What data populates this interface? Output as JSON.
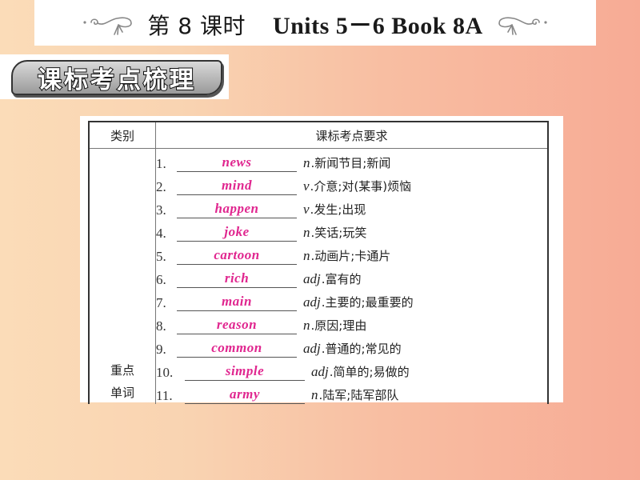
{
  "title": {
    "lesson": "第 8 课时",
    "units": "Units 5－6 Book 8A",
    "left_decoration_icon": "flourish-icon",
    "right_decoration_icon": "flourish-icon"
  },
  "section_badge": {
    "label": "课标考点梳理"
  },
  "table": {
    "headers": {
      "category": "类别",
      "requirement": "课标考点要求"
    },
    "category_label_line1": "重点",
    "category_label_line2": "单词",
    "items": [
      {
        "num": "1.",
        "answer": "news",
        "pos": "n",
        "meaning": "新闻节目;新闻"
      },
      {
        "num": "2.",
        "answer": "mind",
        "pos": "v",
        "meaning": "介意;对(某事)烦恼"
      },
      {
        "num": "3.",
        "answer": "happen",
        "pos": "v",
        "meaning": "发生;出现"
      },
      {
        "num": "4.",
        "answer": "joke",
        "pos": "n",
        "meaning": "笑话;玩笑"
      },
      {
        "num": "5.",
        "answer": "cartoon",
        "pos": "n",
        "meaning": "动画片;卡通片"
      },
      {
        "num": "6.",
        "answer": "rich",
        "pos": "adj",
        "meaning": "富有的"
      },
      {
        "num": "7.",
        "answer": "main",
        "pos": "adj",
        "meaning": "主要的;最重要的"
      },
      {
        "num": "8.",
        "answer": "reason",
        "pos": "n",
        "meaning": "原因;理由"
      },
      {
        "num": "9.",
        "answer": "common",
        "pos": "adj",
        "meaning": "普通的;常见的"
      },
      {
        "num": "10.",
        "answer": "simple",
        "pos": "adj",
        "meaning": "简单的;易做的"
      },
      {
        "num": "11.",
        "answer": "army",
        "pos": "n",
        "meaning": "陆军;陆军部队"
      }
    ]
  },
  "colors": {
    "answer": "#e0268f",
    "background_left": "#fbdcb8",
    "background_right": "#f7ab95"
  }
}
